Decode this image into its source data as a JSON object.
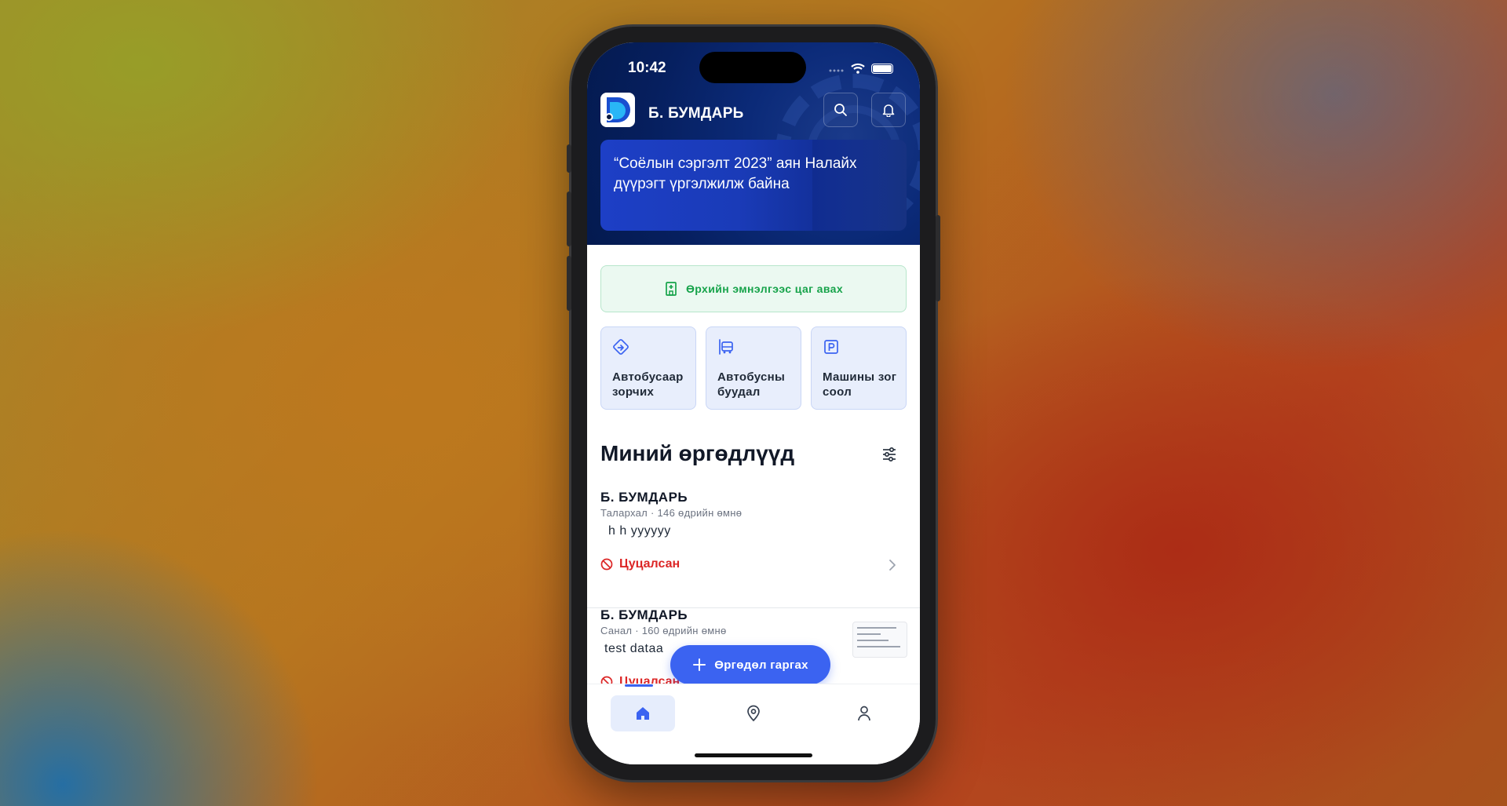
{
  "status_bar": {
    "time": "10:42"
  },
  "header": {
    "user_name": "Б. БУМДАРЬ",
    "banner_text": "“Соёлын сэргэлт 2023” аян Налайх дүүрэгт үргэлжилж байна"
  },
  "appointment": {
    "label": "Өрхийн эмнэлгээс цаг авах"
  },
  "tiles": [
    {
      "label": "Автобусаар зорчих",
      "icon": "route-icon"
    },
    {
      "label": "Автобусны буудал",
      "icon": "bus-stop-icon"
    },
    {
      "label": "Машины зогсоол",
      "icon": "parking-icon"
    }
  ],
  "section": {
    "title": "Миний өргөдлүүд"
  },
  "applications": [
    {
      "name": "Б. БУМДАРЬ",
      "category": "Талархал",
      "time_ago": "146 өдрийн өмнө",
      "body": "h h yyyyyy",
      "status": "Цуцалсан"
    },
    {
      "name": "Б. БУМДАРЬ",
      "category": "Санал",
      "time_ago": "160 өдрийн өмнө",
      "body": "test dataa",
      "status": "Цуцалсан"
    }
  ],
  "fab": {
    "label": "Өргөдөл гаргах"
  },
  "tabbar": {
    "items": [
      "home-icon",
      "map-pin-icon",
      "user-icon"
    ],
    "active": 0
  },
  "colors": {
    "primary": "#3b63f1",
    "header_bg": "#061f5e",
    "success": "#16a34a",
    "danger": "#dc2626",
    "tile_bg": "#e8eefc"
  }
}
